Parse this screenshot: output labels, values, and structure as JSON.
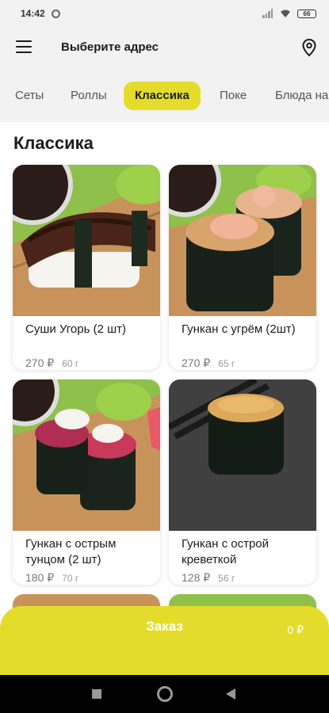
{
  "status": {
    "time": "14:42",
    "battery": "66"
  },
  "header": {
    "address": "Выберите адрес"
  },
  "tabs": [
    {
      "label": "Сеты"
    },
    {
      "label": "Роллы"
    },
    {
      "label": "Классика"
    },
    {
      "label": "Поке"
    },
    {
      "label": "Блюда на"
    }
  ],
  "section": {
    "title": "Классика"
  },
  "products": [
    {
      "name": "Суши Угорь (2 шт)",
      "price": "270 ₽",
      "weight": "60 г"
    },
    {
      "name": "Гункан с угрём (2шт)",
      "price": "270 ₽",
      "weight": "65 г"
    },
    {
      "name": "Гункан с острым тунцом (2 шт)",
      "price": "180 ₽",
      "weight": "70 г"
    },
    {
      "name": "Гункан с острой креветкой",
      "price": "128 ₽",
      "weight": "56 г"
    }
  ],
  "order": {
    "label": "Заказ",
    "sum": "0 ₽"
  },
  "colors": {
    "accent": "#e4dc2a",
    "background": "#f2f2f2"
  }
}
